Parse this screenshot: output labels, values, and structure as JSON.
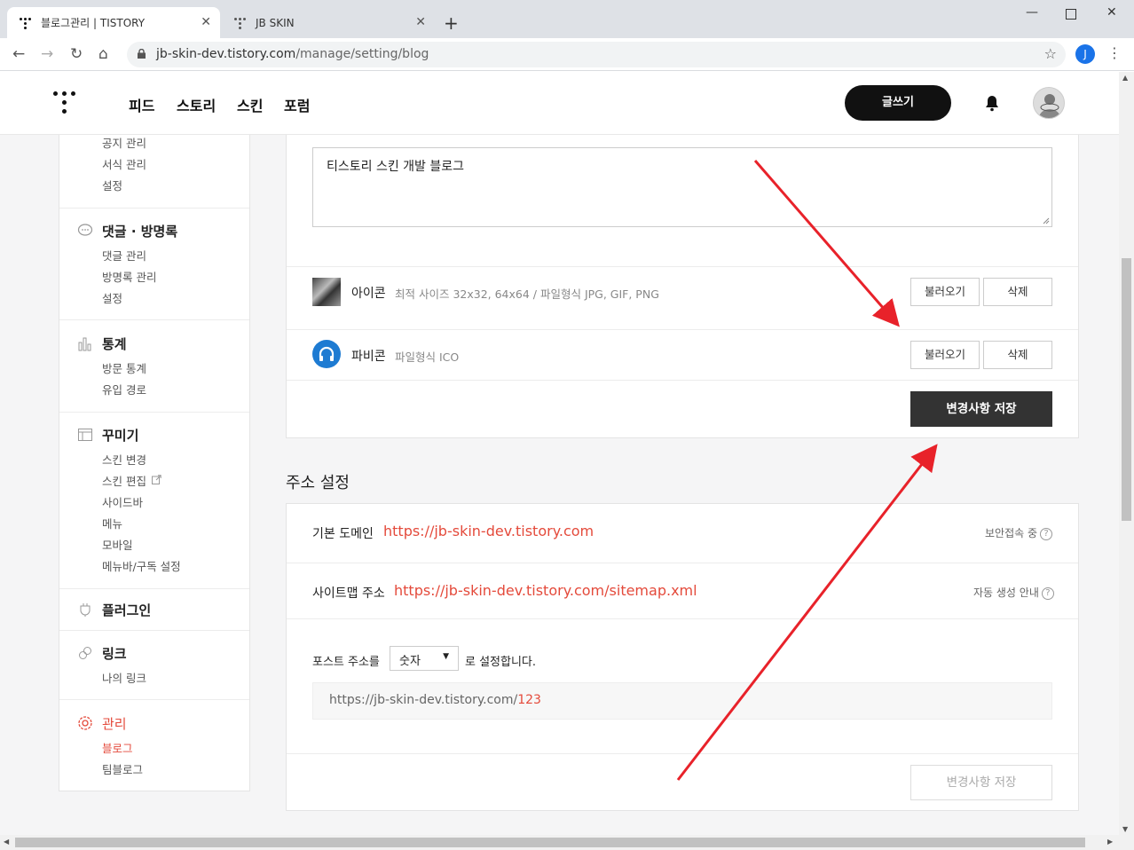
{
  "browser": {
    "tabs": [
      {
        "title": "블로그관리 | TISTORY",
        "active": true
      },
      {
        "title": "JB SKIN",
        "active": false
      }
    ],
    "new_tab": "+",
    "url_host": "jb-skin-dev.tistory.com",
    "url_path": "/manage/setting/blog",
    "profile_initial": "J"
  },
  "header": {
    "nav": [
      "피드",
      "스토리",
      "스킨",
      "포럼"
    ],
    "write_button": "글쓰기"
  },
  "sidebar": {
    "top_items": [
      "공지 관리",
      "서식 관리",
      "설정"
    ],
    "sections": [
      {
        "title": "댓글 · 방명록",
        "icon": "speech-bubble-icon",
        "items": [
          "댓글 관리",
          "방명록 관리",
          "설정"
        ]
      },
      {
        "title": "통계",
        "icon": "bar-chart-icon",
        "items": [
          "방문 통계",
          "유입 경로"
        ]
      },
      {
        "title": "꾸미기",
        "icon": "layout-icon",
        "items": [
          "스킨 변경",
          "스킨 편집",
          "사이드바",
          "메뉴",
          "모바일",
          "메뉴바/구독 설정"
        ]
      },
      {
        "title": "플러그인",
        "icon": "plugin-icon",
        "items": []
      },
      {
        "title": "링크",
        "icon": "link-icon",
        "items": [
          "나의 링크"
        ]
      },
      {
        "title": "관리",
        "icon": "gear-icon",
        "items": [
          "블로그",
          "팀블로그"
        ],
        "active": true
      }
    ]
  },
  "blog_settings": {
    "description_value": "티스토리 스킨 개발 블로그",
    "icon_label": "아이콘",
    "icon_hint": "최적 사이즈 32x32, 64x64 / 파일형식 JPG, GIF, PNG",
    "favicon_label": "파비콘",
    "favicon_hint": "파일형식 ICO",
    "load_button": "불러오기",
    "delete_button": "삭제",
    "save_button": "변경사항 저장"
  },
  "address_settings": {
    "title": "주소 설정",
    "default_domain_label": "기본 도메인",
    "default_domain": "https://jb-skin-dev.tistory.com",
    "secure_label": "보안접속 중",
    "sitemap_label": "사이트맵 주소",
    "sitemap_url": "https://jb-skin-dev.tistory.com/sitemap.xml",
    "sitemap_help": "자동 생성 안내",
    "post_address_prefix": "포스트 주소를",
    "post_address_option": "숫자",
    "post_address_suffix": "로 설정합니다.",
    "preview_base": "https://jb-skin-dev.tistory.com/",
    "preview_id": "123",
    "save_button": "변경사항 저장"
  },
  "colors": {
    "accent_red": "#e44a3b",
    "dark_button": "#333333",
    "arrow": "#e8222a"
  }
}
